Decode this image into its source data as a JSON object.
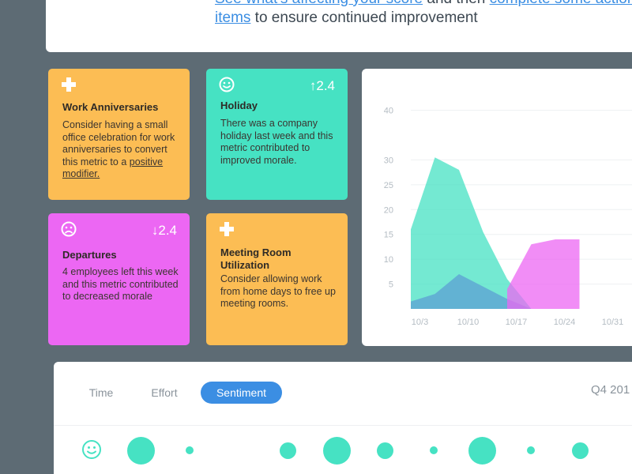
{
  "header": {
    "line1_link1": "See what's affecting your score",
    "line1_mid": " and then ",
    "line1_link2": "complete some action",
    "line2_link": "items",
    "line2_rest": " to ensure continued improvement"
  },
  "cards": [
    {
      "icon": "plus-icon",
      "title": "Work Anniversaries",
      "body": "Consider having a small office celebration for work anniversaries to convert this metric to a ",
      "body_link": "positive modifier.",
      "color": "#fcbd54"
    },
    {
      "icon": "smiley-icon",
      "delta": "↑2.4",
      "title": "Holiday",
      "body": "There was a company holiday last week and this metric contributed to improved morale.",
      "color": "#46e2c3"
    },
    {
      "icon": "frown-icon",
      "delta": "↓2.4",
      "title": "Departures",
      "body": "4 employees left this week and this metric contributed to decreased morale",
      "color": "#ec67f3"
    },
    {
      "icon": "plus-icon",
      "title": "Meeting Room Utilization",
      "body": "Consider allowing work from home days to free up meeting rooms.",
      "color": "#fcbd54"
    }
  ],
  "chart_data": {
    "type": "area",
    "categories": [
      "",
      "10/3",
      "",
      "10/10",
      "",
      "10/17",
      "",
      "10/24",
      "",
      "10/31",
      ""
    ],
    "x_labels": [
      "10/3",
      "10/10",
      "10/17",
      "10/24",
      "10/31"
    ],
    "y_ticks": [
      5,
      10,
      15,
      20,
      25,
      30,
      40
    ],
    "ylim": [
      0,
      42
    ],
    "grid": true,
    "series": [
      {
        "color": "#46e2c3",
        "values": [
          16,
          30.5,
          28,
          15.5,
          6,
          0,
          null,
          null
        ]
      },
      {
        "color": "#5fa8d3",
        "values": [
          1.5,
          3,
          7,
          4.5,
          2,
          0,
          null,
          null
        ]
      },
      {
        "color": "#ec67f3",
        "values": [
          null,
          null,
          null,
          null,
          4,
          13,
          14,
          14
        ]
      }
    ]
  },
  "tabs": [
    {
      "label": "Time",
      "active": false
    },
    {
      "label": "Effort",
      "active": false
    },
    {
      "label": "Sentiment",
      "active": true
    }
  ],
  "quarter_label": "Q4 201",
  "sentiment_dots": [
    {
      "level": "large"
    },
    {
      "level": "small"
    },
    {
      "level": "medium"
    },
    {
      "level": "large"
    },
    {
      "level": "medium"
    },
    {
      "level": "small"
    },
    {
      "level": "large"
    },
    {
      "level": "small"
    },
    {
      "level": "medium"
    }
  ]
}
